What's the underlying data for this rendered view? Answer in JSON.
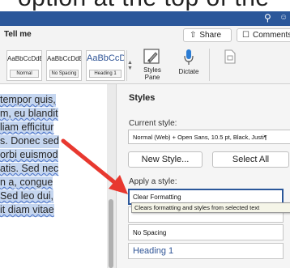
{
  "caption_text": "option at the top of the",
  "titlebar": {
    "search_icon": "search-icon",
    "accent": "#2b579a"
  },
  "toolbar": {
    "tell_me": "Tell me",
    "share_label": "Share",
    "comments_label": "Comments"
  },
  "ribbon": {
    "style_cards": [
      {
        "preview": "AaBbCcDdEe",
        "name": "Normal"
      },
      {
        "preview": "AaBbCcDdEe",
        "name": "No Spacing"
      },
      {
        "preview": "AaBbCcDc",
        "name": "Heading 1"
      }
    ],
    "styles_pane_label_1": "Styles",
    "styles_pane_label_2": "Pane",
    "dictate_label": "Dictate"
  },
  "document": {
    "lines": [
      {
        "a": "tempor quis,",
        "b": ""
      },
      {
        "a": "m, eu blandit",
        "b": ""
      },
      {
        "a": "liam efficitur",
        "b": ""
      },
      {
        "a": "s. Donec sed",
        "b": ""
      },
      {
        "a": "orbi euismod",
        "b": ""
      },
      {
        "a": "atis. Sed nec",
        "b": ""
      },
      {
        "a": "n a, congue",
        "b": ""
      },
      {
        "a": "Sed leo dui,",
        "b": ""
      },
      {
        "a": "it diam vitae",
        "b": ""
      }
    ]
  },
  "styles_pane": {
    "title": "Styles",
    "current_style_label": "Current style:",
    "current_style_value": "Normal (Web) + Open Sans, 10.5 pt, Black, Justi¶",
    "new_style_label": "New Style...",
    "select_all_label": "Select All",
    "apply_label": "Apply a style:",
    "items": {
      "clear_formatting": "Clear Formatting",
      "no_spacing": "No Spacing",
      "heading_1": "Heading 1"
    },
    "tooltip": "Clears formatting and styles from selected text"
  },
  "colors": {
    "arrow": "#e8382f",
    "highlight": "#c5d6f0",
    "heading": "#2f5496"
  }
}
